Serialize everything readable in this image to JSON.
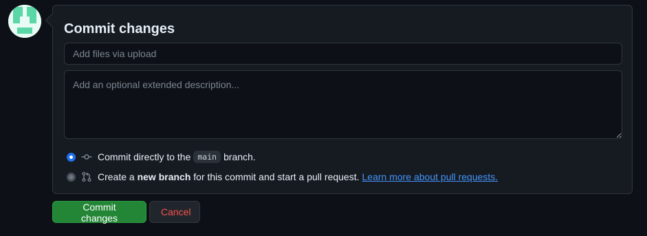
{
  "form": {
    "title": "Commit changes",
    "summary_placeholder": "Add files via upload",
    "description_placeholder": "Add an optional extended description...",
    "option_direct": {
      "prefix": "Commit directly to the",
      "branch": "main",
      "suffix": "branch.",
      "selected": true
    },
    "option_new_branch": {
      "prefix": "Create a",
      "bold": "new branch",
      "suffix": "for this commit and start a pull request.",
      "link": "Learn more about pull requests.",
      "selected": false
    }
  },
  "buttons": {
    "commit_label": "Commit changes",
    "cancel_label": "Cancel"
  },
  "colors": {
    "background": "#0d1117",
    "panel": "#161b22",
    "primary_button": "#238636",
    "cancel_text": "#f85149",
    "link": "#4493f8",
    "avatar": "#5ad6a7"
  },
  "icons": {
    "avatar": "identicon-avatar",
    "direct_commit": "git-commit-icon",
    "new_branch": "git-pull-request-icon"
  }
}
